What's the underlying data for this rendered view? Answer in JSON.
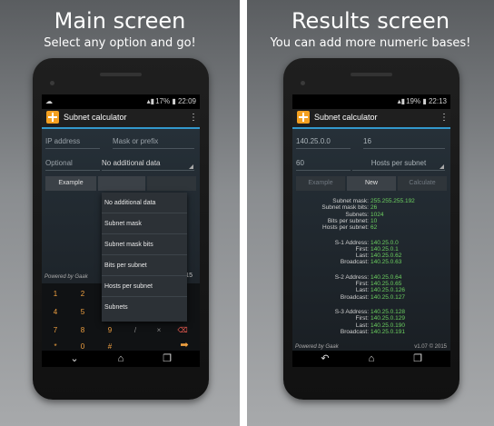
{
  "left": {
    "heading": "Main screen",
    "subheading": "Select any option and go!",
    "status": {
      "battery": "17%",
      "time": "22:09"
    },
    "app_title": "Subnet calculator",
    "ip_placeholder": "IP address",
    "mask_placeholder": "Mask or prefix",
    "optional_placeholder": "Optional",
    "select_value": "No additional data",
    "example_label": "Example",
    "powered_by": "Powered by Gaak",
    "side_number": "15",
    "dropdown": [
      "No additional data",
      "Subnet mask",
      "Subnet mask bits",
      "Bits per subnet",
      "Hosts per subnet",
      "Subnets"
    ],
    "keys": [
      "1",
      "2",
      "4",
      "5",
      "7",
      "8",
      "9",
      "*",
      "0",
      "#"
    ]
  },
  "right": {
    "heading": "Results screen",
    "subheading": "You can add more numeric bases!",
    "status": {
      "battery": "19%",
      "time": "22:13"
    },
    "app_title": "Subnet calculator",
    "ip_value": "140.25.0.0",
    "mask_value": "16",
    "optional_value": "60",
    "select_value": "Hosts per subnet",
    "example_label": "Example",
    "new_label": "New",
    "calculate_label": "Calculate",
    "summary": [
      {
        "k": "Subnet mask:",
        "v": "255.255.255.192"
      },
      {
        "k": "Subnet mask bits:",
        "v": "26"
      },
      {
        "k": "Subnets:",
        "v": "1024"
      },
      {
        "k": "Bits per subnet:",
        "v": "10"
      },
      {
        "k": "Hosts per subnet:",
        "v": "62"
      }
    ],
    "subnets": [
      [
        {
          "k": "S-1 Address:",
          "v": "140.25.0.0"
        },
        {
          "k": "First:",
          "v": "140.25.0.1"
        },
        {
          "k": "Last:",
          "v": "140.25.0.62"
        },
        {
          "k": "Broadcast:",
          "v": "140.25.0.63"
        }
      ],
      [
        {
          "k": "S-2 Address:",
          "v": "140.25.0.64"
        },
        {
          "k": "First:",
          "v": "140.25.0.65"
        },
        {
          "k": "Last:",
          "v": "140.25.0.126"
        },
        {
          "k": "Broadcast:",
          "v": "140.25.0.127"
        }
      ],
      [
        {
          "k": "S-3 Address:",
          "v": "140.25.0.128"
        },
        {
          "k": "First:",
          "v": "140.25.0.129"
        },
        {
          "k": "Last:",
          "v": "140.25.0.190"
        },
        {
          "k": "Broadcast:",
          "v": "140.25.0.191"
        }
      ]
    ],
    "powered_by": "Powered by Gaak",
    "version": "v1.07 © 2015"
  },
  "colors": {
    "accent": "#3398cc",
    "result_value": "#6cd060",
    "key": "#f0a040",
    "logo": "#f4a020"
  }
}
